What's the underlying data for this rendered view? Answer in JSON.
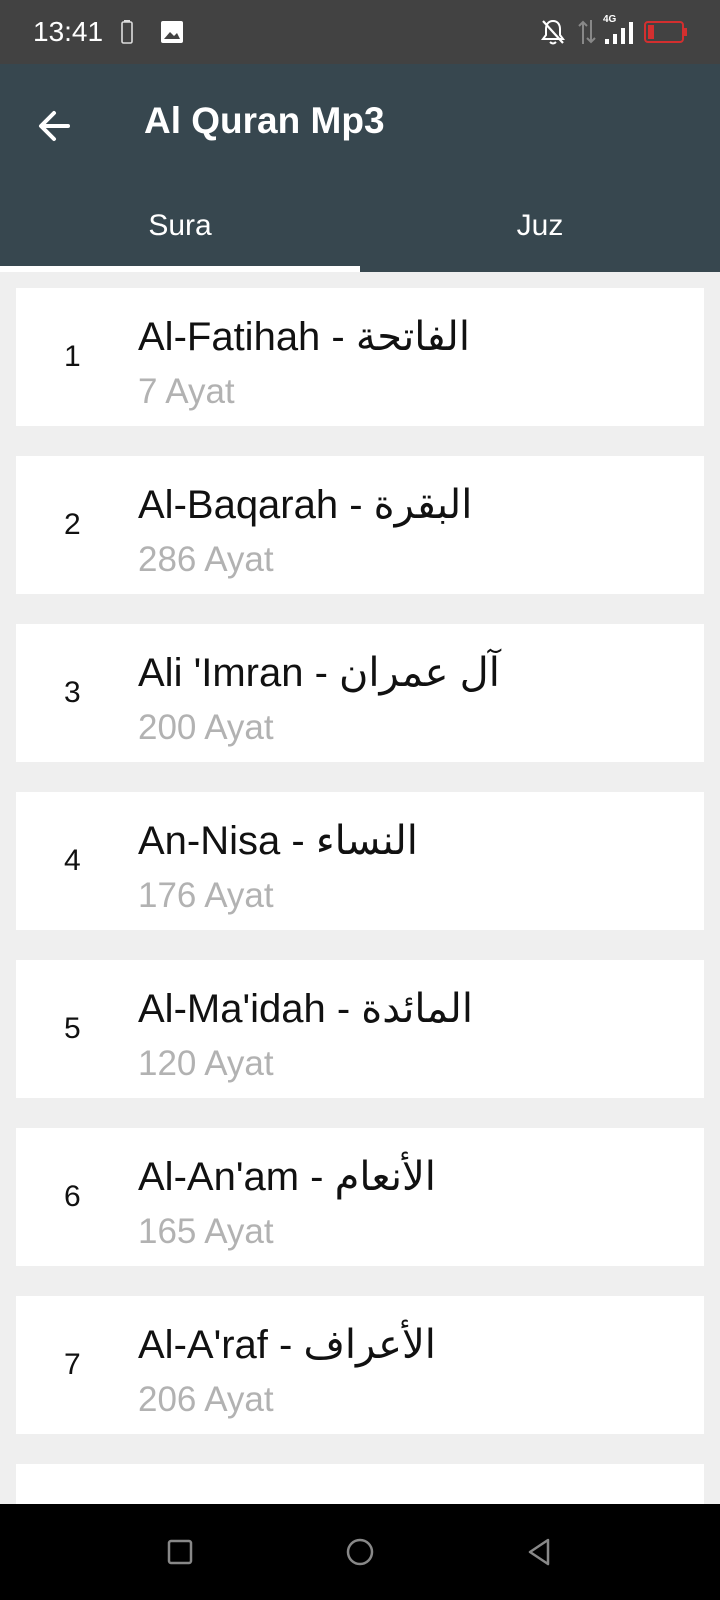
{
  "status": {
    "time": "13:41",
    "network": "4G",
    "icons": [
      "battery-icon",
      "image-icon",
      "notifications-off-icon",
      "data-transfer-icon",
      "signal-icon",
      "battery-low-icon"
    ]
  },
  "appbar": {
    "title": "Al Quran Mp3",
    "back_icon": "arrow-left-icon"
  },
  "tabs": [
    {
      "label": "Sura",
      "selected": true
    },
    {
      "label": "Juz",
      "selected": false
    }
  ],
  "suras": [
    {
      "number": "1",
      "title": "Al-Fatihah - الفاتحة",
      "ayat": "7 Ayat"
    },
    {
      "number": "2",
      "title": "Al-Baqarah - البقرة",
      "ayat": "286 Ayat"
    },
    {
      "number": "3",
      "title": "Ali 'Imran - آل عمران",
      "ayat": "200 Ayat"
    },
    {
      "number": "4",
      "title": "An-Nisa - النساء",
      "ayat": "176 Ayat"
    },
    {
      "number": "5",
      "title": "Al-Ma'idah - المائدة",
      "ayat": "120 Ayat"
    },
    {
      "number": "6",
      "title": "Al-An'am - الأنعام",
      "ayat": "165 Ayat"
    },
    {
      "number": "7",
      "title": "Al-A'raf - الأعراف",
      "ayat": "206 Ayat"
    }
  ],
  "colors": {
    "appbar": "#37474f",
    "statusbar": "#424242",
    "background": "#efefef",
    "battery_alert": "#d32f2f"
  },
  "navigation": {
    "icons": [
      "recent-apps-icon",
      "home-icon",
      "back-icon"
    ]
  }
}
